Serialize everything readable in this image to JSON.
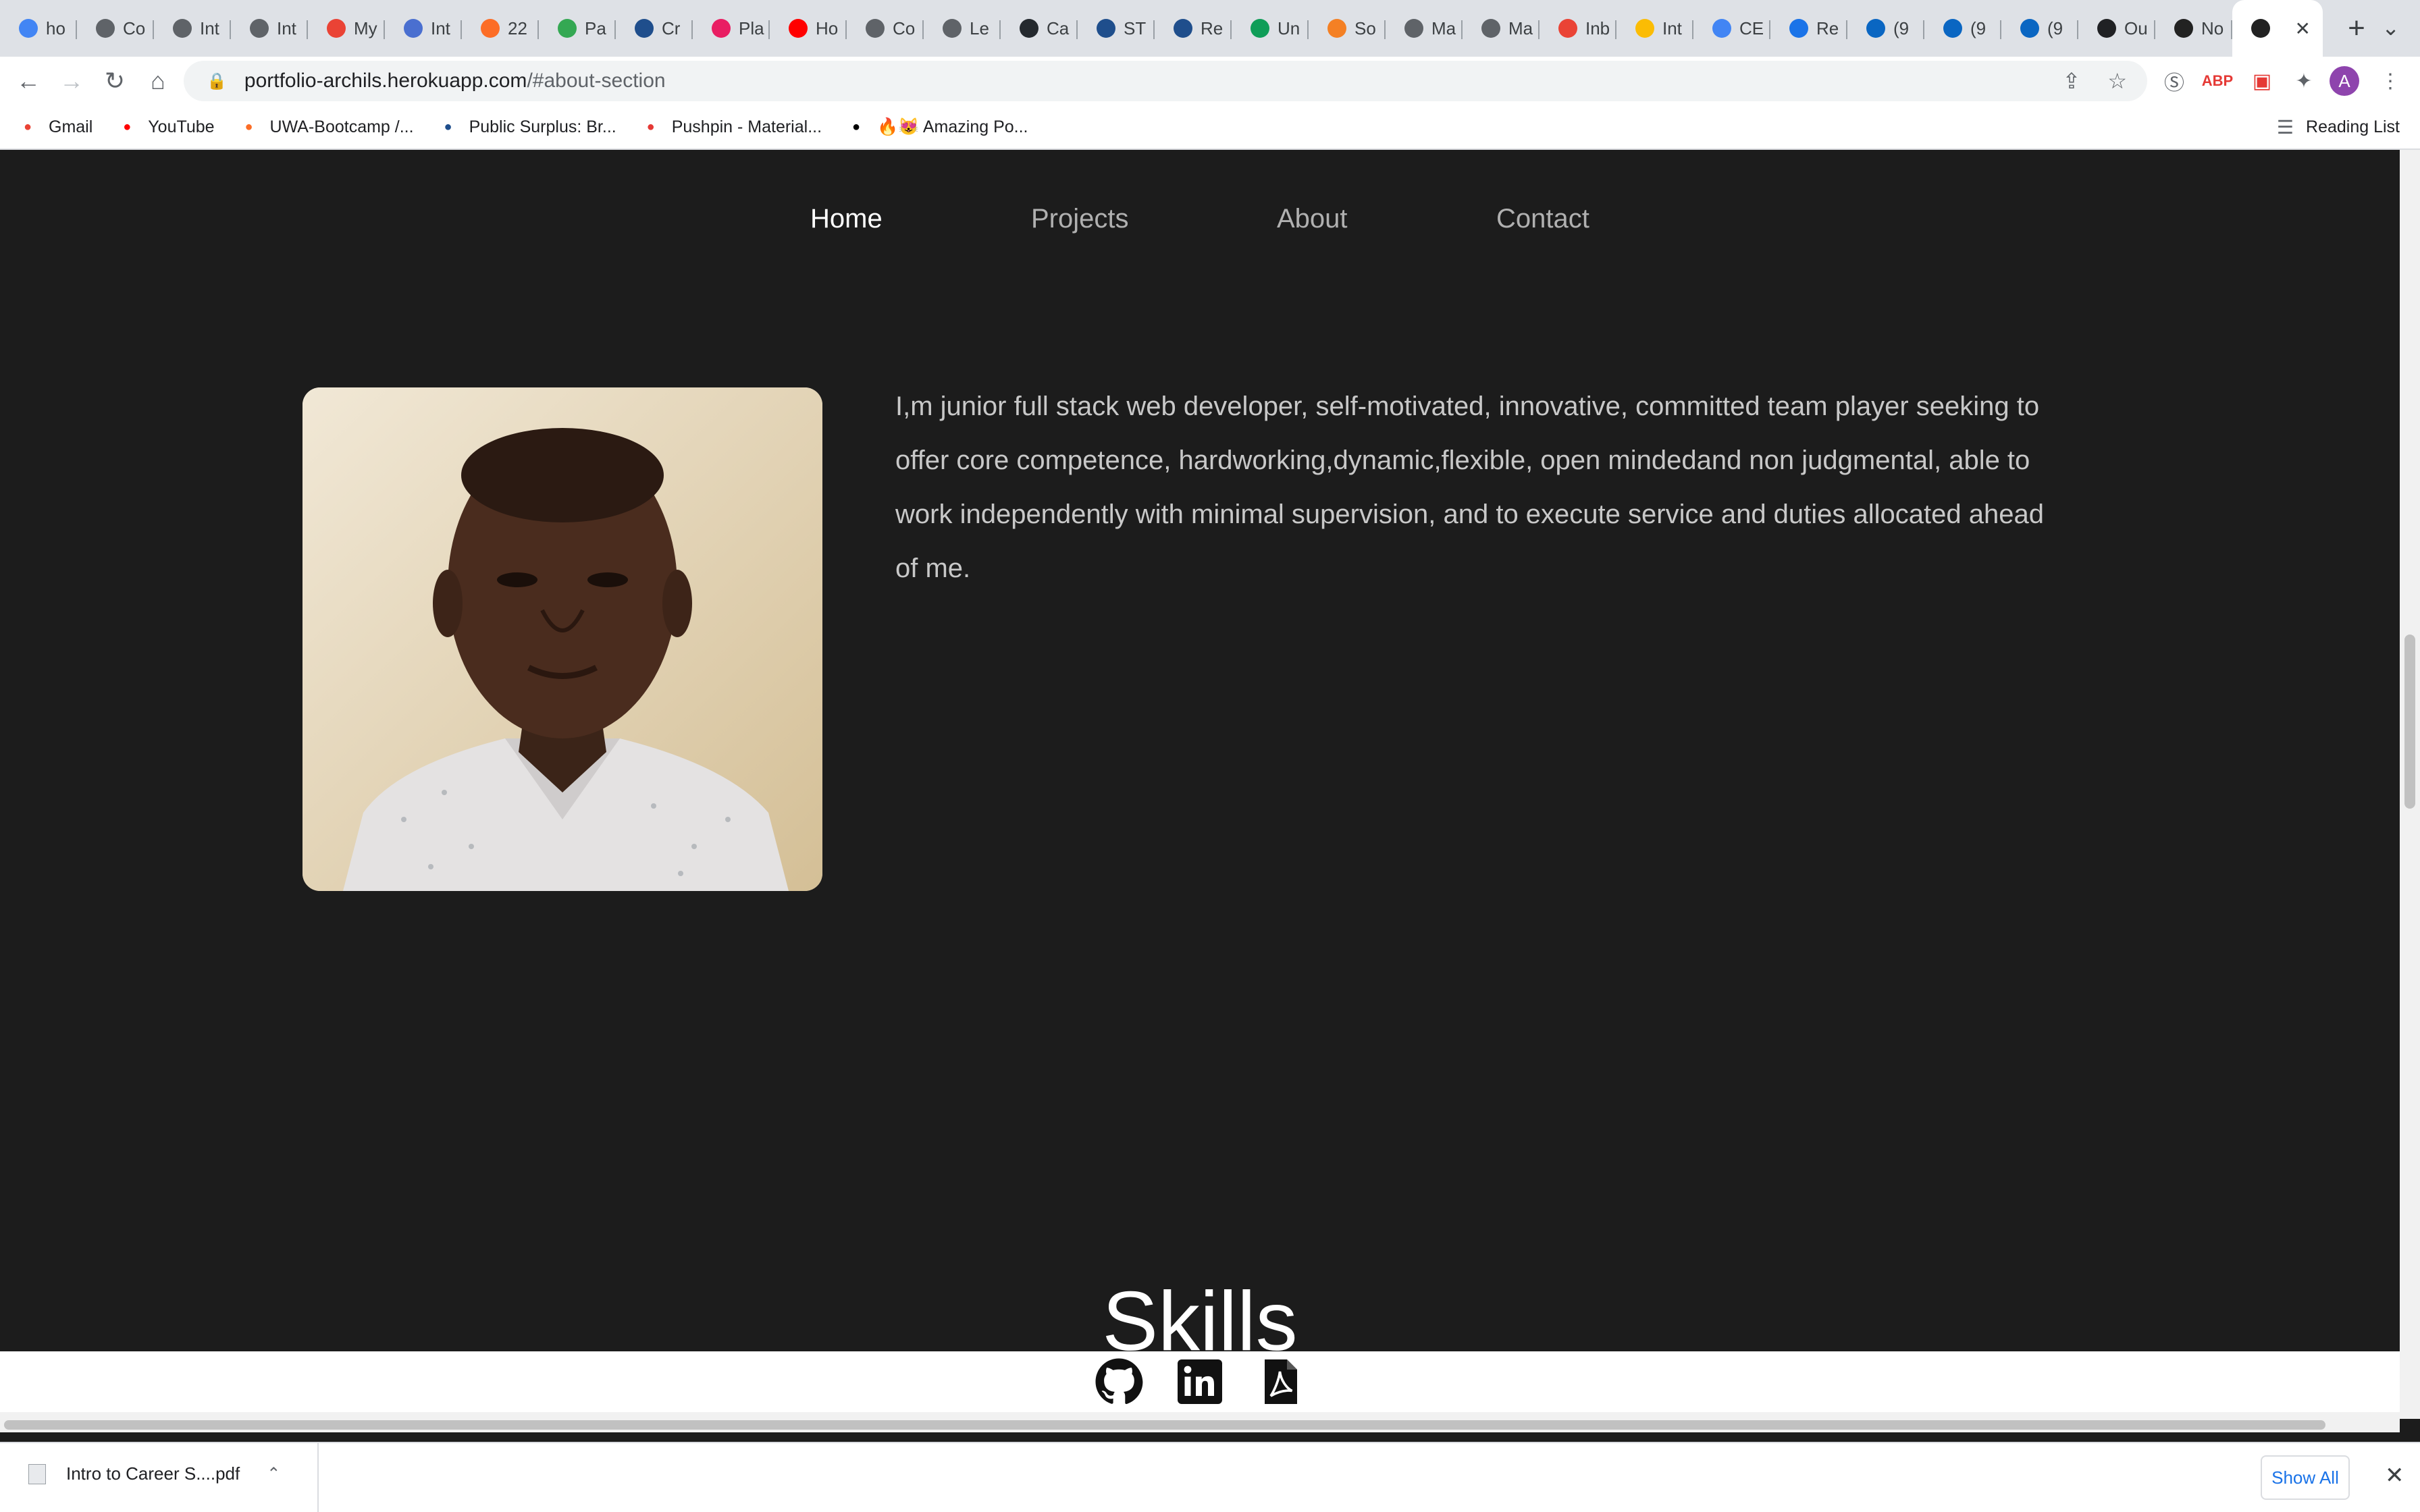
{
  "browser": {
    "tabs": [
      {
        "label": "ho",
        "icon": "google-icon",
        "color": "#4285f4"
      },
      {
        "label": "Co",
        "icon": "globe-icon",
        "color": "#5f6368"
      },
      {
        "label": "Int",
        "icon": "globe-icon",
        "color": "#5f6368"
      },
      {
        "label": "Int",
        "icon": "globe-icon",
        "color": "#5f6368"
      },
      {
        "label": "My",
        "icon": "gmail-icon",
        "color": "#ea4335"
      },
      {
        "label": "Int",
        "icon": "font-icon",
        "color": "#4a6fd0"
      },
      {
        "label": "22",
        "icon": "gitlab-icon",
        "color": "#fc6d26"
      },
      {
        "label": "Pa",
        "icon": "link-icon",
        "color": "#34a853"
      },
      {
        "label": "Cr",
        "icon": "coursera-icon",
        "color": "#1f4e8c"
      },
      {
        "label": "Pla",
        "icon": "puzzle-icon",
        "color": "#e91e63"
      },
      {
        "label": "Ho",
        "icon": "youtube-icon",
        "color": "#ff0000"
      },
      {
        "label": "Co",
        "icon": "globe-icon",
        "color": "#5f6368"
      },
      {
        "label": "Le",
        "icon": "globe-icon",
        "color": "#5f6368"
      },
      {
        "label": "Ca",
        "icon": "github-icon",
        "color": "#24292e"
      },
      {
        "label": "ST",
        "icon": "stats-icon",
        "color": "#1f4e8c"
      },
      {
        "label": "Re",
        "icon": "cin-icon",
        "color": "#1f4e8c"
      },
      {
        "label": "Un",
        "icon": "sheets-icon",
        "color": "#0f9d58"
      },
      {
        "label": "So",
        "icon": "stackoverflow-icon",
        "color": "#f48024"
      },
      {
        "label": "Ma",
        "icon": "grid-icon",
        "color": "#5f6368"
      },
      {
        "label": "Ma",
        "icon": "grid-icon",
        "color": "#5f6368"
      },
      {
        "label": "Inb",
        "icon": "gmail-icon",
        "color": "#ea4335"
      },
      {
        "label": "Int",
        "icon": "drive-icon",
        "color": "#fbbc04"
      },
      {
        "label": "CE",
        "icon": "docs-icon",
        "color": "#4285f4"
      },
      {
        "label": "Re",
        "icon": "2u-icon",
        "color": "#1a73e8"
      },
      {
        "label": "(9",
        "icon": "linkedin-icon",
        "color": "#0a66c2"
      },
      {
        "label": "(9",
        "icon": "linkedin-icon",
        "color": "#0a66c2"
      },
      {
        "label": "(9",
        "icon": "linkedin-icon",
        "color": "#0a66c2"
      },
      {
        "label": "Ou",
        "icon": "cf-icon",
        "color": "#202124"
      },
      {
        "label": "No",
        "icon": "react-icon",
        "color": "#222"
      }
    ],
    "active_tab_icon": "react-icon",
    "url_host": "portfolio-archils.herokuapp.com",
    "url_path": "/#about-section",
    "avatar_letter": "A",
    "bookmarks": [
      {
        "label": "Gmail",
        "icon": "gmail-icon",
        "color": "#ea4335"
      },
      {
        "label": "YouTube",
        "icon": "youtube-icon",
        "color": "#ff0000"
      },
      {
        "label": "UWA-Bootcamp /...",
        "icon": "gitlab-icon",
        "color": "#fc6d26"
      },
      {
        "label": "Public Surplus: Br...",
        "icon": "ps-icon",
        "color": "#1f4e8c"
      },
      {
        "label": "Pushpin - Material...",
        "icon": "m-icon",
        "color": "#e53935"
      },
      {
        "label": "🔥😻 Amazing Po...",
        "icon": "dev-icon",
        "color": "#000000"
      }
    ],
    "reading_list": "Reading List"
  },
  "nav": {
    "home": "Home",
    "projects": "Projects",
    "about": "About",
    "contact": "Contact"
  },
  "about": {
    "bio": "I,m junior full stack web developer, self-motivated, innovative, committed team player seeking to offer core competence, hardworking,dynamic,flexible, open mindedand non judgmental, able to work independently with minimal supervision, and to execute service and duties allocated ahead of me."
  },
  "skills": {
    "heading": "Skills"
  },
  "footer": {
    "icons": [
      "github-icon",
      "linkedin-icon",
      "pdf-icon"
    ]
  },
  "downloads": {
    "file_name": "Intro to Career S....pdf",
    "show_all": "Show All"
  }
}
